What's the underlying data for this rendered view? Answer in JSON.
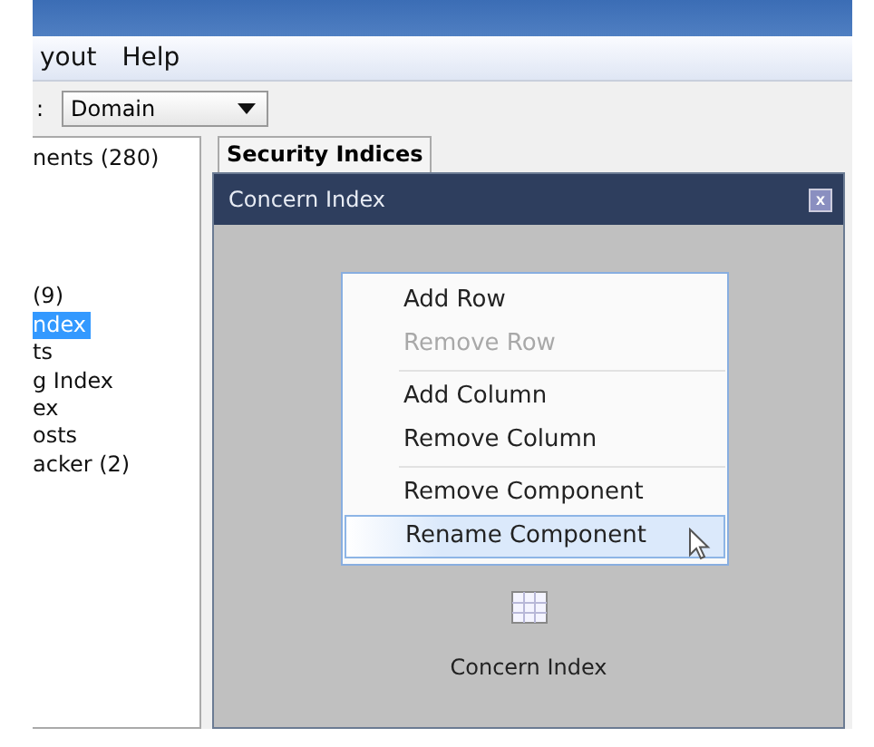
{
  "menu_bar": {
    "items": [
      {
        "label": "yout"
      },
      {
        "label": "Help"
      }
    ]
  },
  "toolbar": {
    "label": ":",
    "dropdown": {
      "value": "Domain"
    }
  },
  "tree": {
    "groups": [
      [
        {
          "label": "nents (280)",
          "selected": false
        }
      ],
      [
        {
          "label": "(9)",
          "selected": false
        },
        {
          "label": "ndex",
          "selected": true
        },
        {
          "label": "ts",
          "selected": false
        },
        {
          "label": "g Index",
          "selected": false
        },
        {
          "label": "ex",
          "selected": false
        },
        {
          "label": "osts",
          "selected": false
        },
        {
          "label": "acker (2)",
          "selected": false
        }
      ]
    ]
  },
  "tabs": [
    {
      "label": "Security Indices",
      "selected": true
    }
  ],
  "inner_window": {
    "title": "Concern Index",
    "close": "x",
    "context_menu": {
      "groups": [
        [
          {
            "label": "Add Row",
            "disabled": false,
            "selected": false
          },
          {
            "label": "Remove Row",
            "disabled": true,
            "selected": false
          }
        ],
        [
          {
            "label": "Add Column",
            "disabled": false,
            "selected": false
          },
          {
            "label": "Remove Column",
            "disabled": false,
            "selected": false
          }
        ],
        [
          {
            "label": "Remove Component",
            "disabled": false,
            "selected": false
          },
          {
            "label": "Rename Component",
            "disabled": false,
            "selected": true
          }
        ]
      ]
    },
    "component": {
      "label": "Concern Index"
    }
  }
}
